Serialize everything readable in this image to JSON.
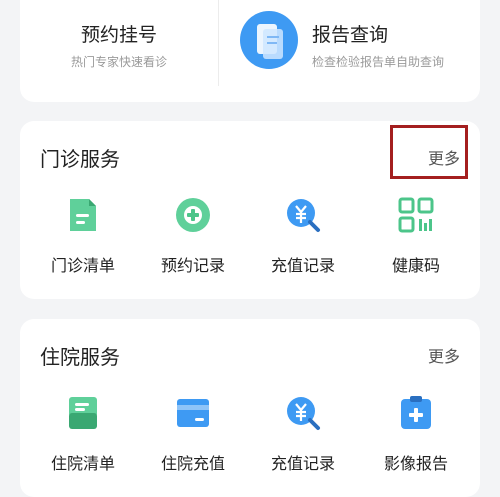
{
  "quick_actions": {
    "appointment": {
      "title": "预约挂号",
      "subtitle": "热门专家快速看诊"
    },
    "report": {
      "title": "报告查询",
      "subtitle": "检查检验报告单自助查询",
      "icon": "report-document-icon"
    }
  },
  "outpatient": {
    "title": "门诊服务",
    "more": "更多",
    "items": [
      {
        "label": "门诊清单",
        "icon": "document-list-icon"
      },
      {
        "label": "预约记录",
        "icon": "add-circle-icon"
      },
      {
        "label": "充值记录",
        "icon": "yuan-search-icon"
      },
      {
        "label": "健康码",
        "icon": "qr-code-icon"
      }
    ]
  },
  "inpatient": {
    "title": "住院服务",
    "more": "更多",
    "items": [
      {
        "label": "住院清单",
        "icon": "stack-list-icon"
      },
      {
        "label": "住院充值",
        "icon": "card-icon"
      },
      {
        "label": "充值记录",
        "icon": "yuan-search-icon"
      },
      {
        "label": "影像报告",
        "icon": "clipboard-plus-icon"
      }
    ]
  },
  "colors": {
    "green": "#4cc58a",
    "blue": "#3e9af3",
    "highlight": "#a41f1f"
  }
}
